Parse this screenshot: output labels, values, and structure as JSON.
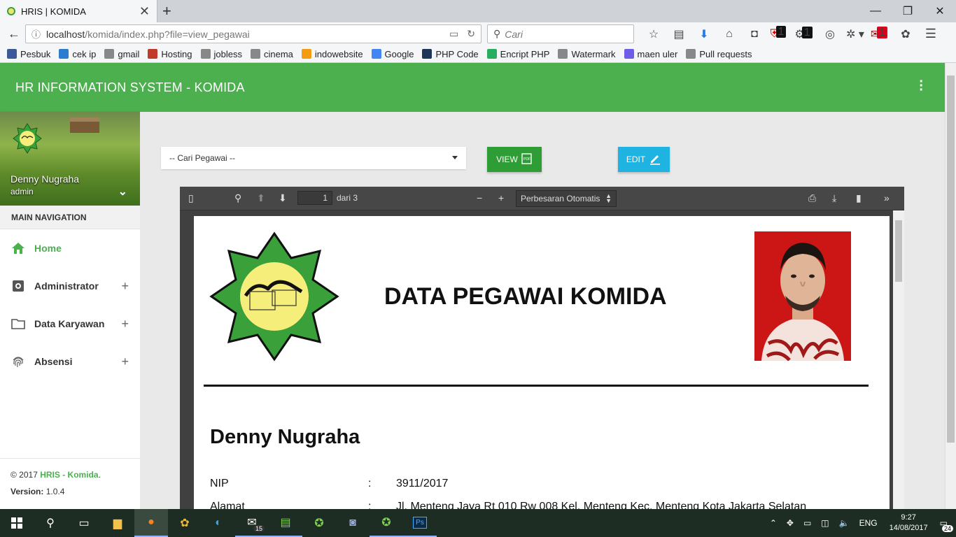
{
  "browser": {
    "tab_title": "HRIS | KOMIDA",
    "url_host": "localhost",
    "url_path": "/komida/index.php?file=view_pegawai",
    "search_placeholder": "Cari",
    "badge_ublock": "1",
    "badge_1": "1",
    "badge_2": "1"
  },
  "bookmarks": [
    {
      "label": "Pesbuk",
      "color": "#3b5998"
    },
    {
      "label": "cek ip",
      "color": "#2b7bd1"
    },
    {
      "label": "gmail",
      "color": "#888888"
    },
    {
      "label": "Hosting",
      "color": "#c0392b"
    },
    {
      "label": "jobless",
      "color": "#888888"
    },
    {
      "label": "cinema",
      "color": "#888888"
    },
    {
      "label": "indowebsite",
      "color": "#f39c12"
    },
    {
      "label": "Google",
      "color": "#4285f4"
    },
    {
      "label": "PHP Code",
      "color": "#1d3557"
    },
    {
      "label": "Encript PHP",
      "color": "#27ae60"
    },
    {
      "label": "Watermark",
      "color": "#888888"
    },
    {
      "label": "maen uler",
      "color": "#6c5ce7"
    },
    {
      "label": "Pull requests",
      "color": "#888888"
    }
  ],
  "app": {
    "header_title": "HR INFORMATION SYSTEM - KOMIDA",
    "accent": "#4cb04f"
  },
  "sidebar": {
    "user_name": "Denny Nugraha",
    "user_role": "admin",
    "nav_header": "MAIN NAVIGATION",
    "items": [
      {
        "label": "Home",
        "icon": "home-icon"
      },
      {
        "label": "Administrator",
        "icon": "gear-icon"
      },
      {
        "label": "Data Karyawan",
        "icon": "folder-icon"
      },
      {
        "label": "Absensi",
        "icon": "fingerprint-icon"
      }
    ],
    "footer_copy": "© 2017",
    "footer_brand": "HRIS - Komida",
    "footer_version_label": "Version:",
    "footer_version": "1.0.4"
  },
  "toolbar": {
    "select_value": "-- Cari Pegawai --",
    "view_label": "VIEW",
    "edit_label": "EDIT"
  },
  "pdf_viewer": {
    "page_number": "1",
    "page_of": "dari 3",
    "zoom": "Perbesaran Otomatis"
  },
  "document": {
    "title": "DATA PEGAWAI KOMIDA",
    "employee_name": "Denny Nugraha",
    "fields": [
      {
        "label": "NIP",
        "sep": ":",
        "value": "3911/2017"
      },
      {
        "label": "Alamat",
        "sep": ":",
        "value": "Jl. Menteng Jaya Rt 010 Rw 008 Kel. Menteng Kec. Menteng Kota Jakarta Selatan"
      }
    ]
  },
  "taskbar": {
    "mail_badge": "15",
    "language": "ENG",
    "time": "9:27",
    "date": "14/08/2017",
    "notif_count": "24"
  }
}
